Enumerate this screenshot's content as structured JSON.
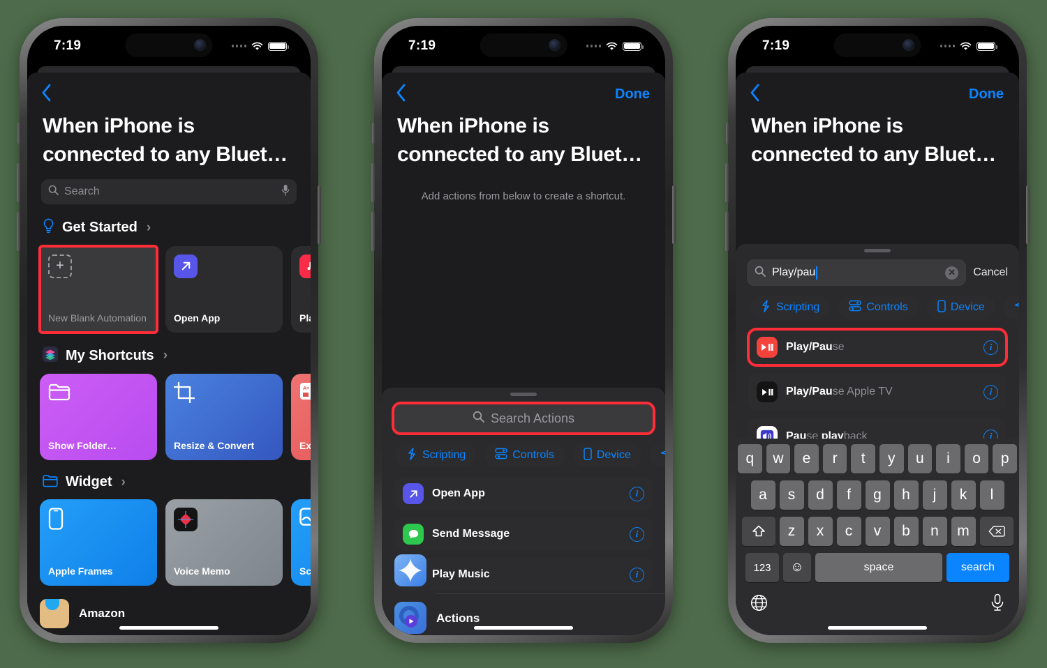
{
  "background_color": "#4d6b4a",
  "status_bar": {
    "time": "7:19",
    "wifi_icon": "wifi-icon",
    "battery_icon": "battery-icon",
    "signal_icon": "signal-dots-icon"
  },
  "phone1": {
    "nav": {
      "back_icon": "chevron-left-icon"
    },
    "title": "When iPhone is connected to any Bluet…",
    "search": {
      "placeholder": "Search",
      "search_icon": "search-icon",
      "mic_icon": "microphone-icon"
    },
    "sections": [
      {
        "icon": "lightbulb-icon",
        "label": "Get Started",
        "chevron": "›",
        "cards": [
          {
            "label": "New Blank Automation",
            "icon": "plus-dashed-square-icon",
            "style": "blank",
            "highlighted": true
          },
          {
            "label": "Open App",
            "icon": "open-app-arrow-icon",
            "icon_color": "#5856e8",
            "style": "plain"
          },
          {
            "label": "Pla",
            "icon": "music-note-icon",
            "icon_color": "#fa2d48",
            "style": "plain"
          }
        ]
      },
      {
        "icon": "shortcuts-icon",
        "label": "My Shortcuts",
        "chevron": "›",
        "cards": [
          {
            "label": "Show Folder…",
            "icon": "folder-icon",
            "color": "#bf5af2"
          },
          {
            "label": "Resize & Convert",
            "icon": "crop-icon",
            "color": "#3b6fd4"
          },
          {
            "label": "Ext",
            "icon": "text-image-icon",
            "color": "#e8605f"
          }
        ]
      },
      {
        "icon": "folder-outline-icon",
        "label": "Widget",
        "chevron": "›",
        "cards": [
          {
            "label": "Apple Frames",
            "icon": "iphone-icon",
            "color": "#1a8ff5"
          },
          {
            "label": "Voice Memo",
            "icon": "waveform-icon",
            "color": "#8e9196"
          },
          {
            "label": "Sca",
            "icon": "scan-doc-icon",
            "color": "#1a8ff5"
          }
        ]
      }
    ],
    "bottom_app": {
      "label": "Amazon",
      "icon": "amazon-icon"
    }
  },
  "phone2": {
    "nav": {
      "back_icon": "chevron-left-icon",
      "done_label": "Done"
    },
    "title": "When iPhone is connected to any Bluet…",
    "subtitle": "Add actions from below to create a shortcut.",
    "sheet": {
      "grabber": "drag-handle",
      "search_actions": {
        "placeholder": "Search Actions",
        "search_icon": "search-icon",
        "highlighted": true
      },
      "chips": [
        {
          "label": "Scripting",
          "icon": "scripting-icon"
        },
        {
          "label": "Controls",
          "icon": "controls-icon"
        },
        {
          "label": "Device",
          "icon": "device-icon"
        },
        {
          "label": "",
          "icon": "share-icon"
        }
      ],
      "actions": [
        {
          "label": "Open App",
          "icon": "open-app-arrow-icon",
          "icon_color": "#5856e8",
          "info_icon": "info-icon"
        },
        {
          "label": "Send Message",
          "icon": "messages-icon",
          "icon_color": "#2dc84d",
          "info_icon": "info-icon"
        },
        {
          "label": "Play Music",
          "icon": "music-note-icon",
          "icon_color": "#fa2d48",
          "info_icon": "info-icon"
        }
      ],
      "app_rows": [
        {
          "icon": "shortcuts-app-icon"
        },
        {
          "icon": "actions-app-icon",
          "label": "Actions"
        }
      ]
    }
  },
  "phone3": {
    "nav": {
      "back_icon": "chevron-left-icon",
      "done_label": "Done"
    },
    "title": "When iPhone is connected to any Bluet…",
    "sheet": {
      "grabber": "drag-handle",
      "search": {
        "value": "Play/pau",
        "search_icon": "search-icon",
        "clear_icon": "clear-circle-icon",
        "cancel_label": "Cancel"
      },
      "chips": [
        {
          "label": "Scripting",
          "icon": "scripting-icon"
        },
        {
          "label": "Controls",
          "icon": "controls-icon"
        },
        {
          "label": "Device",
          "icon": "device-icon"
        },
        {
          "label": "",
          "icon": "share-icon"
        }
      ],
      "results": [
        {
          "match": "Play/Pau",
          "rest": "se",
          "icon": "play-pause-icon",
          "icon_color": "#f4433c",
          "info_icon": "info-icon",
          "highlighted": true
        },
        {
          "match": "Play/Pau",
          "rest": "se Apple TV",
          "icon": "play-pause-dark-icon",
          "icon_color": "#141414",
          "info_icon": "info-icon"
        },
        {
          "match": "Pau",
          "rest": "se ",
          "match2": "play",
          "rest2": "back",
          "icon": "speaker-icon",
          "icon_color": "#ffffff",
          "info_icon": "info-icon"
        }
      ]
    },
    "keyboard": {
      "row1": [
        "q",
        "w",
        "e",
        "r",
        "t",
        "y",
        "u",
        "i",
        "o",
        "p"
      ],
      "row2": [
        "a",
        "s",
        "d",
        "f",
        "g",
        "h",
        "j",
        "k",
        "l"
      ],
      "row3": [
        "z",
        "x",
        "c",
        "v",
        "b",
        "n",
        "m"
      ],
      "shift_icon": "shift-icon",
      "backspace_icon": "backspace-icon",
      "numbers_label": "123",
      "emoji_icon": "emoji-icon",
      "space_label": "space",
      "return_label": "search",
      "globe_icon": "globe-icon",
      "dictation_icon": "microphone-icon"
    }
  }
}
